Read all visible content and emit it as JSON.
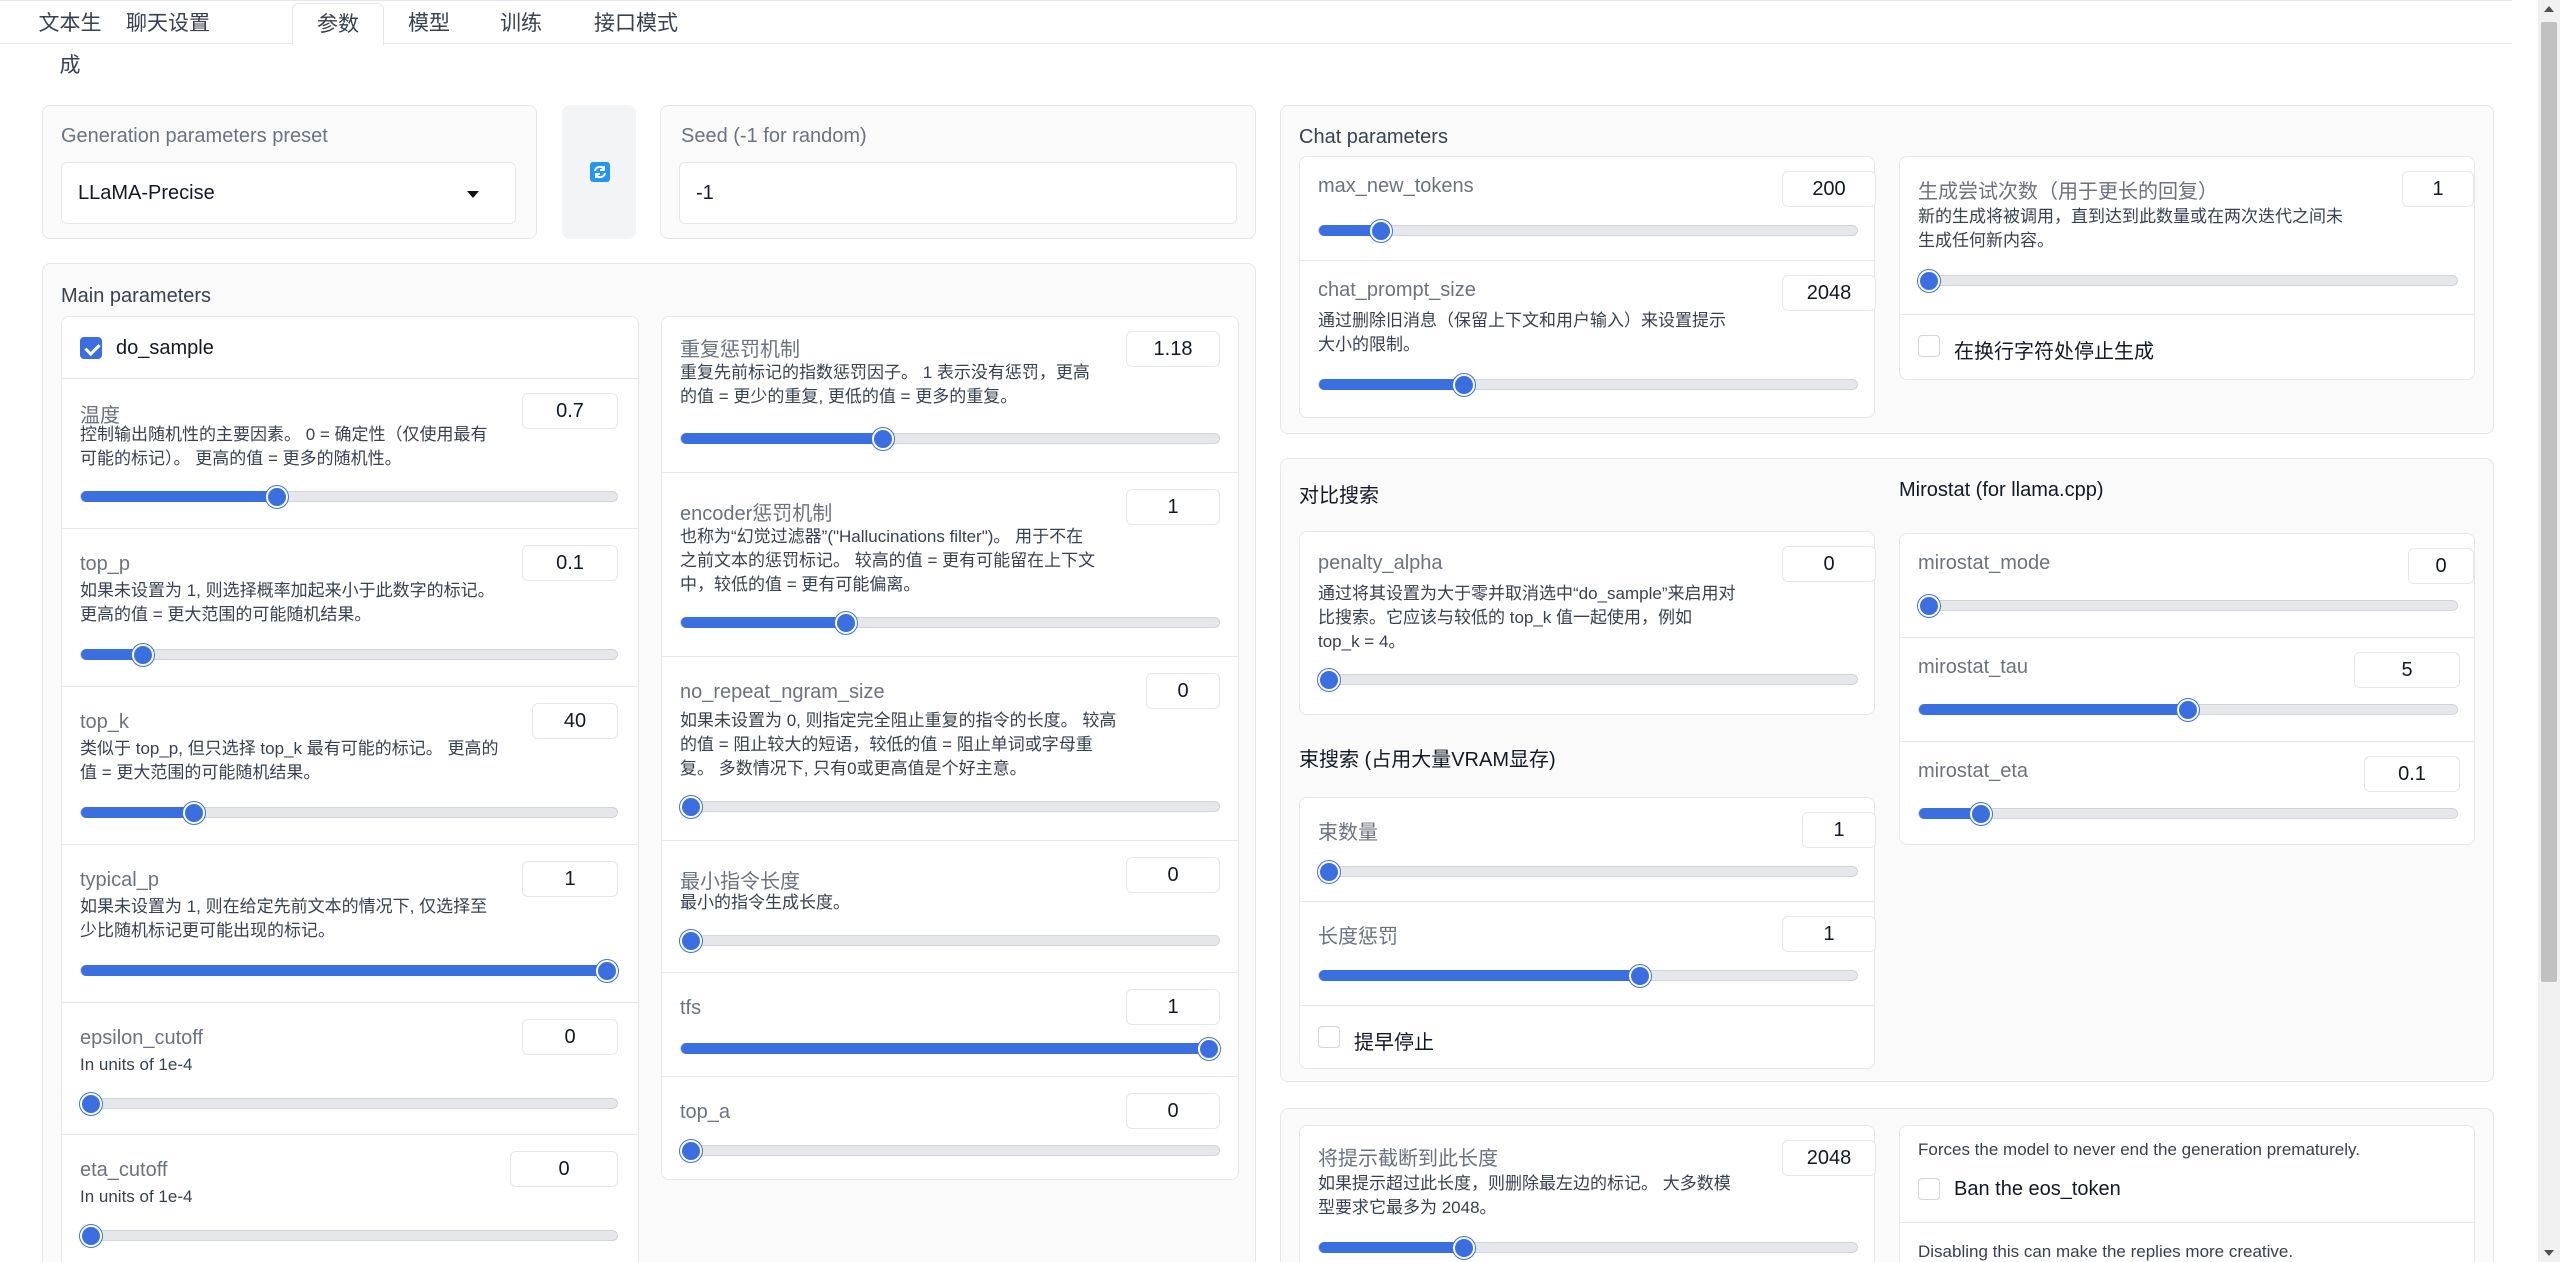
{
  "tabs": [
    "文本生成",
    "聊天设置",
    "参数",
    "模型",
    "训练",
    "接口模式"
  ],
  "preset": {
    "label": "Generation parameters preset",
    "value": "LLaMA-Precise"
  },
  "seed": {
    "label": "Seed (-1 for random)",
    "value": "-1"
  },
  "main": {
    "title": "Main parameters",
    "do_sample": "do_sample",
    "temperature": {
      "label": "温度",
      "desc1": "控制输出随机性的主要因素。 0 = 确定性（仅使用最有",
      "desc2": "可能的标记）。 更高的值 = 更多的随机性。",
      "value": "0.7",
      "level": 0.36
    },
    "top_p": {
      "label": "top_p",
      "desc1": "如果未设置为 1, 则选择概率加起来小于此数字的标记。",
      "desc2": "更高的值 = 更大范围的可能随机结果。",
      "value": "0.1",
      "level": 0.1
    },
    "top_k": {
      "label": "top_k",
      "desc1": "类似于 top_p, 但只选择 top_k 最有可能的标记。 更高的",
      "desc2": "值 = 更大范围的可能随机结果。",
      "value": "40",
      "level": 0.2
    },
    "typical_p": {
      "label": "typical_p",
      "desc1": "如果未设置为 1, 则在给定先前文本的情况下, 仅选择至",
      "desc2": "少比随机标记更可能出现的标记。",
      "value": "1",
      "level": 1
    },
    "epsilon_cutoff": {
      "label": "epsilon_cutoff",
      "desc1": "In units of 1e-4",
      "value": "0",
      "level": 0
    },
    "eta_cutoff": {
      "label": "eta_cutoff",
      "desc1": "In units of 1e-4",
      "value": "0",
      "level": 0
    },
    "repetition_penalty": {
      "label": "重复惩罚机制",
      "desc1": "重复先前标记的指数惩罚因子。 1 表示没有惩罚，更高",
      "desc2": "的值 = 更少的重复, 更低的值 = 更多的重复。",
      "value": "1.18",
      "level": 0.37
    },
    "encoder_penalty": {
      "label": "encoder惩罚机制",
      "desc1": "也称为“幻觉过滤器”(\"Hallucinations filter\")。 用于不在",
      "desc2": "之前文本的惩罚标记。 较高的值 = 更有可能留在上下文",
      "desc3": "中，较低的值 = 更有可能偏离。",
      "value": "1",
      "level": 0.3
    },
    "no_repeat": {
      "label": "no_repeat_ngram_size",
      "desc1": "如果未设置为 0, 则指定完全阻止重复的指令的长度。 较高",
      "desc2": "的值 = 阻止较大的短语，较低的值 = 阻止单词或字母重",
      "desc3": "复。 多数情况下, 只有0或更高值是个好主意。",
      "value": "0",
      "level": 0
    },
    "min_length": {
      "label": "最小指令长度",
      "desc1": "最小的指令生成长度。",
      "value": "0",
      "level": 0
    },
    "tfs": {
      "label": "tfs",
      "value": "1",
      "level": 1
    },
    "top_a": {
      "label": "top_a",
      "value": "0",
      "level": 0
    }
  },
  "chat": {
    "title": "Chat parameters",
    "max_new_tokens": {
      "label": "max_new_tokens",
      "value": "200",
      "level": 0.1
    },
    "chat_prompt_size": {
      "label": "chat_prompt_size",
      "desc1": "通过删除旧消息（保留上下文和用户输入）来设置提示",
      "desc2": "大小的限制。",
      "value": "2048",
      "level": 0.26
    },
    "attempts": {
      "label": "生成尝试次数（用于更长的回复）",
      "desc1": "新的生成将被调用，直到达到此数量或在两次迭代之间未",
      "desc2": "生成任何新内容。",
      "value": "1",
      "level": 0
    },
    "stop_newline": "在换行字符处停止生成"
  },
  "contrastive": {
    "title": "对比搜索",
    "penalty_alpha": {
      "label": "penalty_alpha",
      "desc1": "通过将其设置为大于零并取消选中“do_sample”来启用对",
      "desc2": "比搜索。它应该与较低的 top_k 值一起使用，例如",
      "desc3": "top_k = 4。",
      "value": "0",
      "level": 0
    }
  },
  "beam": {
    "title": "束搜索 (占用大量VRAM显存)",
    "num_beams": {
      "label": "束数量",
      "value": "1",
      "level": 0
    },
    "length_penalty": {
      "label": "长度惩罚",
      "value": "1",
      "level": 0.6
    },
    "early_stopping": "提早停止"
  },
  "mirostat": {
    "title": "Mirostat (for llama.cpp)",
    "mode": {
      "label": "mirostat_mode",
      "value": "0",
      "level": 0
    },
    "tau": {
      "label": "mirostat_tau",
      "value": "5",
      "level": 0.5
    },
    "eta": {
      "label": "mirostat_eta",
      "value": "0.1",
      "level": 0.1
    }
  },
  "truncate": {
    "label": "将提示截断到此长度",
    "desc1": "如果提示超过此长度，则删除最左边的标记。 大多数模",
    "desc2": "型要求它最多为 2048。",
    "value": "2048",
    "level": 0.26
  },
  "eos": {
    "desc": "Forces the model to never end the generation prematurely.",
    "label": "Ban the eos_token",
    "desc2": "Disabling this can make the replies more creative."
  },
  "icons": {
    "refresh": "refresh-icon",
    "dropdown": "chevron-down-icon"
  },
  "colors": {
    "accent": "#3b6fe0"
  }
}
